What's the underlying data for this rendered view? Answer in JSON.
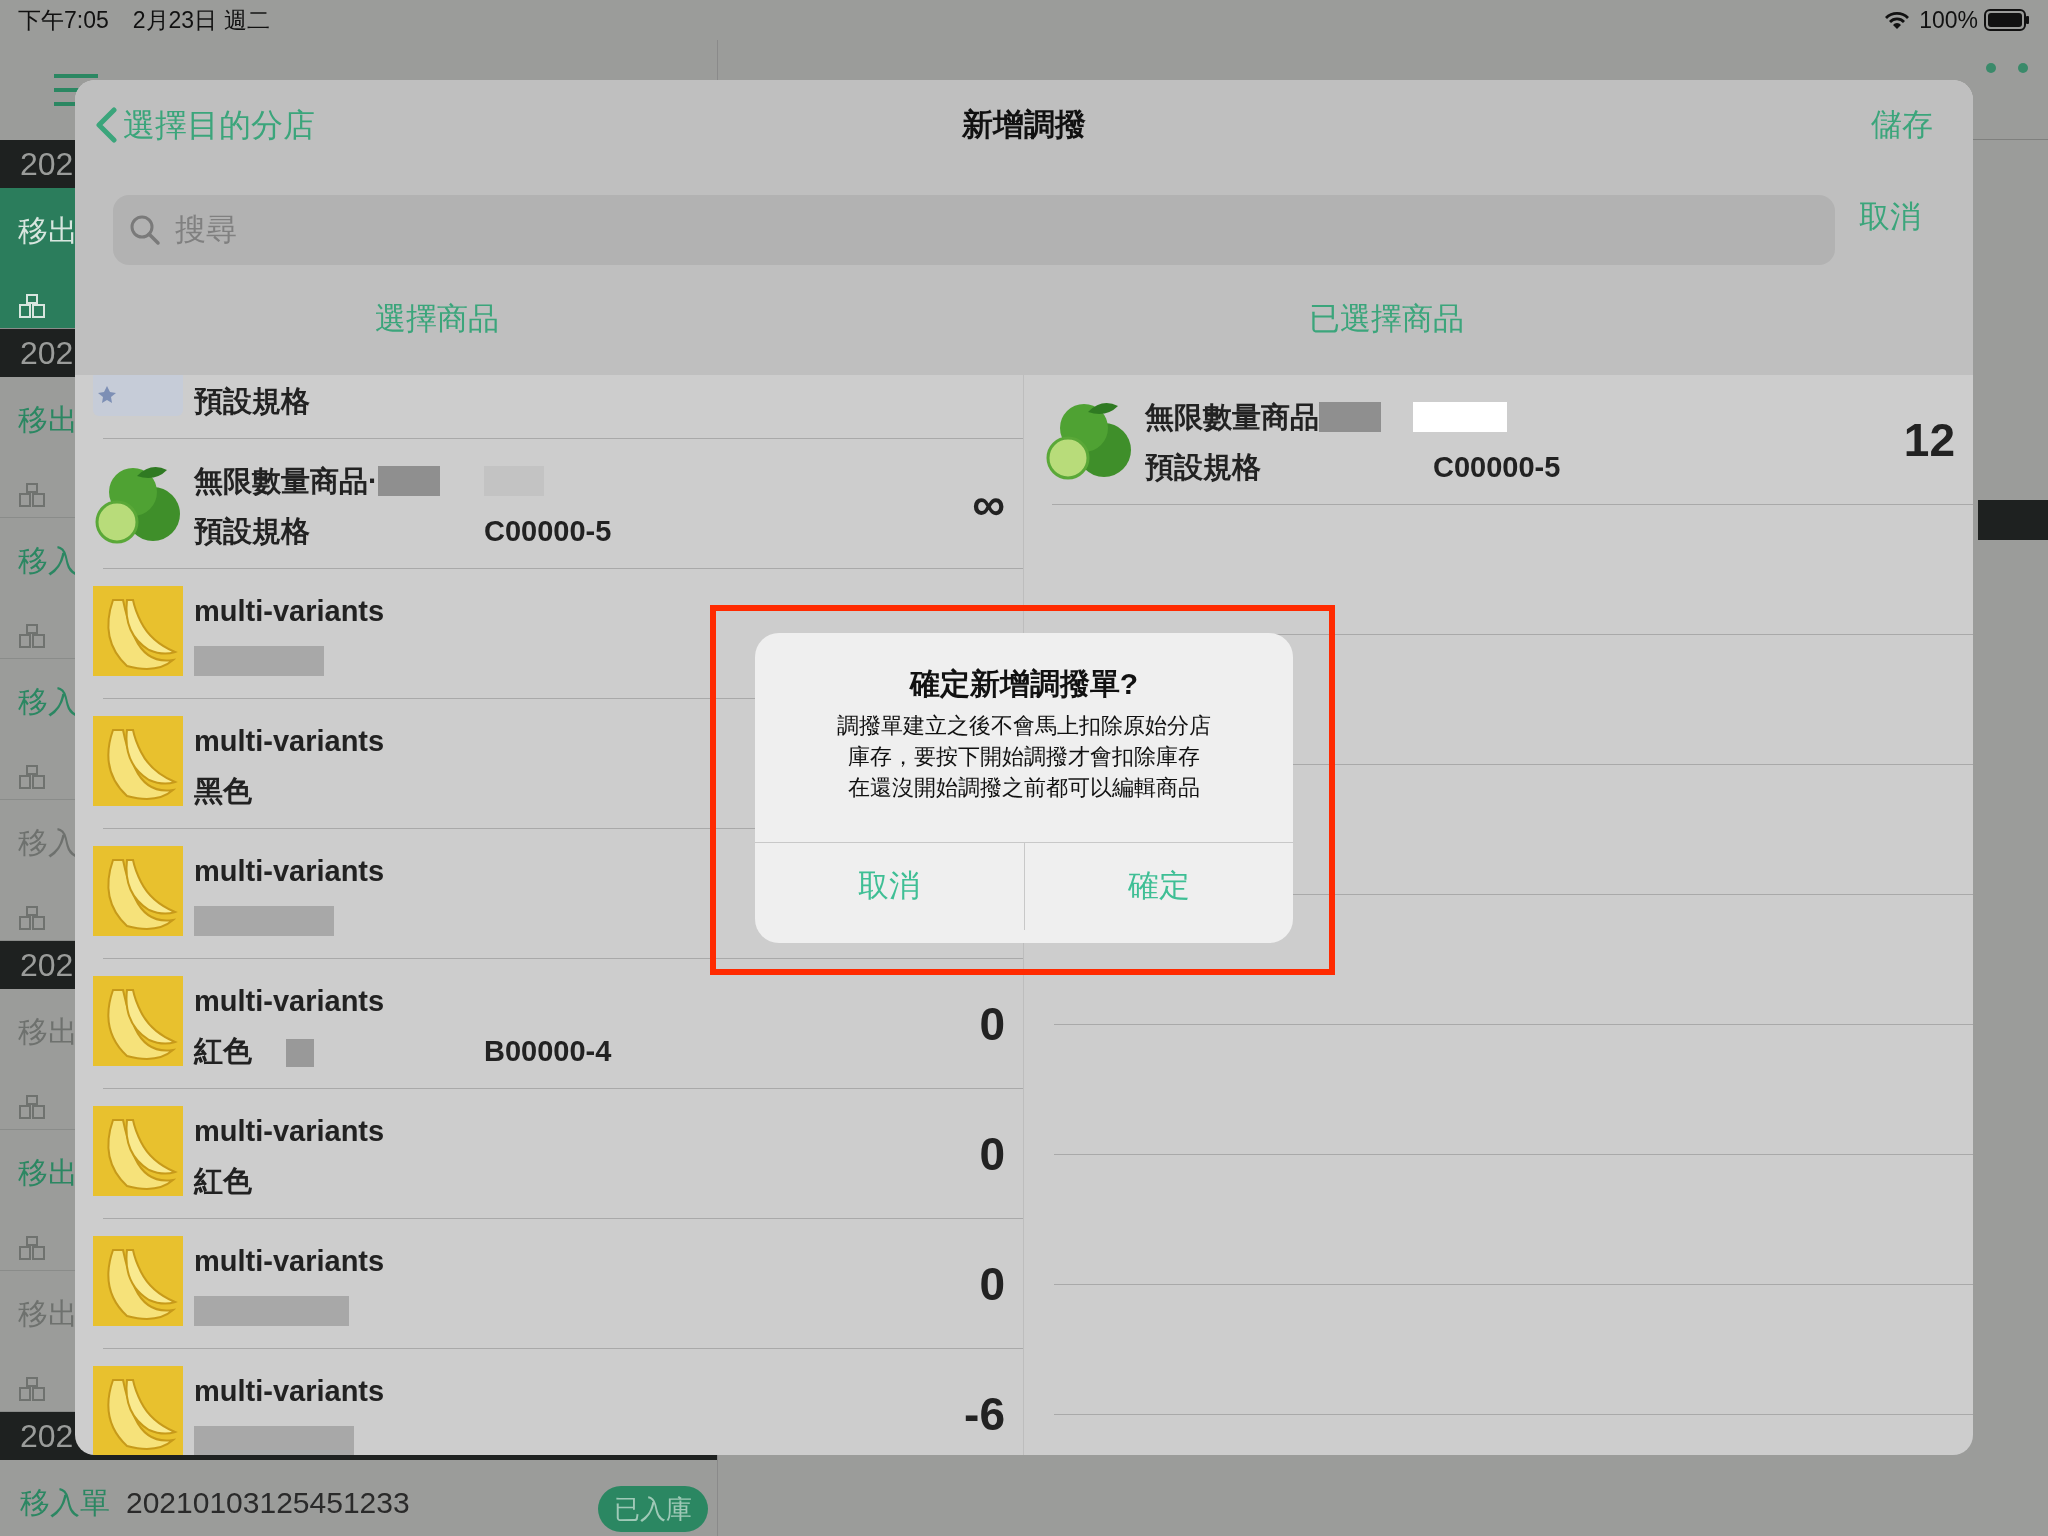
{
  "status_bar": {
    "time": "下午7:05",
    "date": "2月23日 週二",
    "battery": "100%"
  },
  "sidebar": [
    {
      "kind": "header",
      "text": "202"
    },
    {
      "kind": "order",
      "text": "移出",
      "selected": true,
      "color": "#d8e6df"
    },
    {
      "kind": "header",
      "text": "202"
    },
    {
      "kind": "order",
      "text": "移出",
      "selected": false,
      "color": "#2b8762"
    },
    {
      "kind": "order",
      "text": "移入",
      "selected": false,
      "color": "#2b8762"
    },
    {
      "kind": "order",
      "text": "移入",
      "selected": false,
      "color": "#2b8762"
    },
    {
      "kind": "order",
      "text": "移入",
      "selected": false,
      "color": "#6e716e"
    },
    {
      "kind": "header",
      "text": "202"
    },
    {
      "kind": "order",
      "text": "移出",
      "selected": false,
      "color": "#6e716e"
    },
    {
      "kind": "order",
      "text": "移出",
      "selected": false,
      "color": "#2b8762"
    },
    {
      "kind": "order",
      "text": "移出",
      "selected": false,
      "color": "#6e716e"
    },
    {
      "kind": "header",
      "text": "202"
    },
    {
      "kind": "detail",
      "text": "移入單",
      "number": "20210103125451233",
      "badge": "已入庫",
      "color": "#2b8762"
    }
  ],
  "sheet": {
    "back": "選擇目的分店",
    "title": "新增調撥",
    "save": "儲存",
    "search": {
      "placeholder": "搜尋"
    },
    "cancel": "取消",
    "columns": [
      "選擇商品",
      "已選擇商品"
    ],
    "products": [
      {
        "kind": "placeholder",
        "variant": "預設規格"
      },
      {
        "kind": "lime",
        "name": "無限數量商品·",
        "variant": "預設規格",
        "code": "C00000-5",
        "qty": "∞",
        "name_redacted": true
      },
      {
        "kind": "banana",
        "name": "multi-variants",
        "variant_redacted": true
      },
      {
        "kind": "banana",
        "name": "multi-variants",
        "variant": "黑色"
      },
      {
        "kind": "banana",
        "name": "multi-variants",
        "variant_redacted": true
      },
      {
        "kind": "banana",
        "name": "multi-variants",
        "variant": "紅色",
        "swatch": true,
        "code": "B00000-4",
        "qty": "0"
      },
      {
        "kind": "banana",
        "name": "multi-variants",
        "variant": "紅色",
        "qty": "0"
      },
      {
        "kind": "banana",
        "name": "multi-variants",
        "variant_redacted": true,
        "qty": "0"
      },
      {
        "kind": "banana",
        "name": "multi-variants",
        "variant_redacted": true,
        "qty": "-6"
      }
    ],
    "selected_products": [
      {
        "kind": "lime",
        "name": "無限數量商品",
        "variant": "預設規格",
        "code": "C00000-5",
        "qty": "12",
        "name_redacted": true
      }
    ]
  },
  "alert": {
    "title": "確定新增調撥單?",
    "message": [
      "調撥單建立之後不會馬上扣除原始分店",
      "庫存，要按下開始調撥才會扣除庫存",
      "在還沒開始調撥之前都可以編輯商品"
    ],
    "buttons": [
      "取消",
      "確定"
    ]
  }
}
